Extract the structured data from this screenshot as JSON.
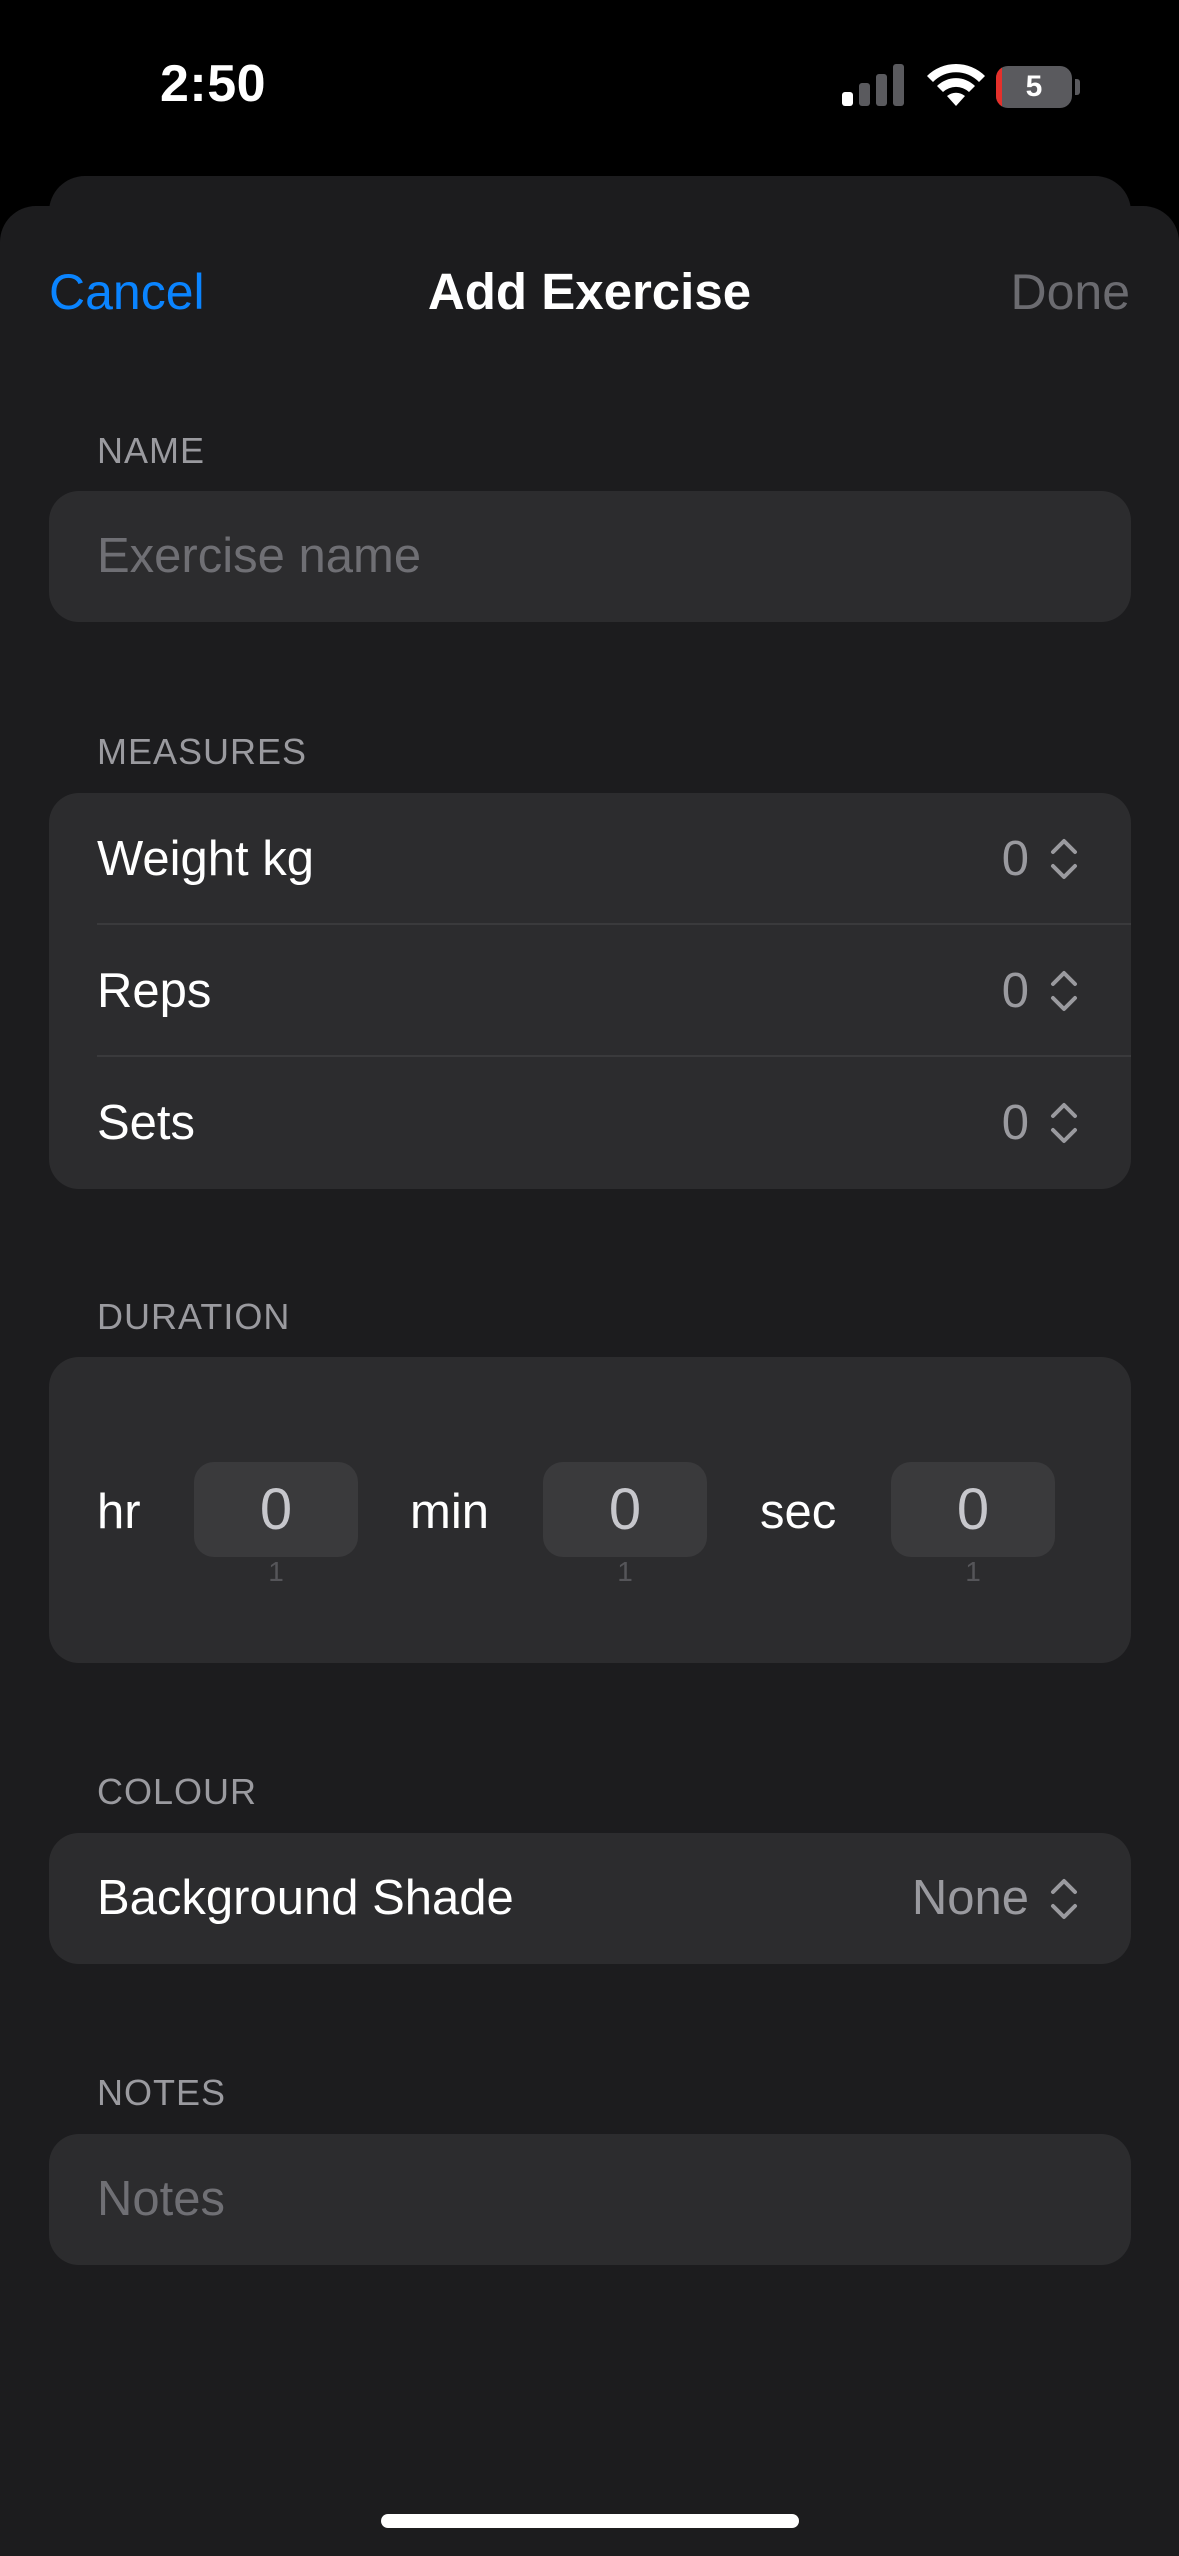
{
  "status_bar": {
    "time": "2:50",
    "battery_level": "5",
    "battery_color": "#e5302b",
    "signal_icon": "cellular-signal-icon",
    "wifi_icon": "wifi-icon"
  },
  "nav": {
    "cancel_label": "Cancel",
    "title": "Add Exercise",
    "done_label": "Done"
  },
  "name_section": {
    "header": "NAME",
    "placeholder": "Exercise name"
  },
  "measures_section": {
    "header": "MEASURES",
    "rows": [
      {
        "label": "Weight kg",
        "value": "0"
      },
      {
        "label": "Reps",
        "value": "0"
      },
      {
        "label": "Sets",
        "value": "0"
      }
    ]
  },
  "duration_section": {
    "header": "DURATION",
    "fields": [
      {
        "unit": "hr",
        "value": "0",
        "next": "1"
      },
      {
        "unit": "min",
        "value": "0",
        "next": "1"
      },
      {
        "unit": "sec",
        "value": "0",
        "next": "1"
      }
    ]
  },
  "colour_section": {
    "header": "COLOUR",
    "label": "Background Shade",
    "value": "None"
  },
  "notes_section": {
    "header": "NOTES",
    "placeholder": "Notes"
  },
  "colors": {
    "accent": "#0a84ff",
    "sheet_background": "#1c1c1e",
    "card_background": "#2c2c2e",
    "disabled_text": "#6b6b70"
  }
}
